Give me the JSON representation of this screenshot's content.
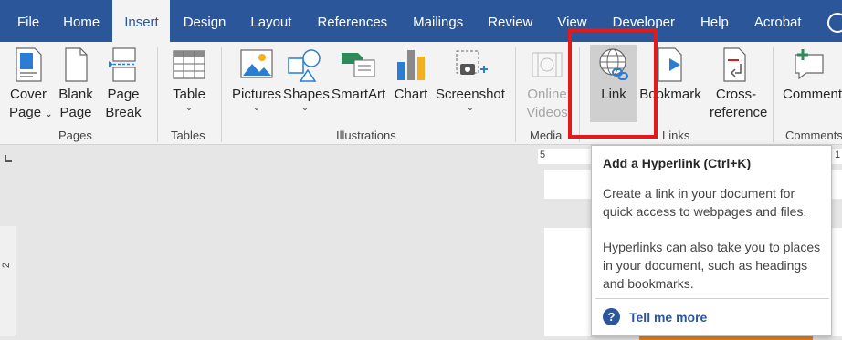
{
  "tabs": [
    {
      "label": "File"
    },
    {
      "label": "Home"
    },
    {
      "label": "Insert"
    },
    {
      "label": "Design"
    },
    {
      "label": "Layout"
    },
    {
      "label": "References"
    },
    {
      "label": "Mailings"
    },
    {
      "label": "Review"
    },
    {
      "label": "View"
    },
    {
      "label": "Developer"
    },
    {
      "label": "Help"
    },
    {
      "label": "Acrobat"
    }
  ],
  "active_tab": "Insert",
  "ribbon": {
    "pages": {
      "group_label": "Pages",
      "cover_page": {
        "line1": "Cover",
        "line2": "Page"
      },
      "blank_page": {
        "line1": "Blank",
        "line2": "Page"
      },
      "page_break": {
        "line1": "Page",
        "line2": "Break"
      }
    },
    "tables": {
      "group_label": "Tables",
      "table": {
        "label": "Table"
      }
    },
    "illustrations": {
      "group_label": "Illustrations",
      "pictures": {
        "label": "Pictures"
      },
      "shapes": {
        "label": "Shapes"
      },
      "smartart": {
        "label": "SmartArt"
      },
      "chart": {
        "label": "Chart"
      },
      "screenshot": {
        "label": "Screenshot"
      }
    },
    "media": {
      "group_label": "Media",
      "online_videos": {
        "line1": "Online",
        "line2": "Videos"
      }
    },
    "links": {
      "group_label": "Links",
      "link": {
        "label": "Link"
      },
      "bookmark": {
        "label": "Bookmark"
      },
      "cross_reference": {
        "line1": "Cross-",
        "line2": "reference"
      }
    },
    "comments": {
      "group_label": "Comments",
      "comment": {
        "label": "Comment"
      }
    }
  },
  "ruler": {
    "h_numbers": [
      "5",
      "1"
    ],
    "v_number": "2"
  },
  "tooltip": {
    "title": "Add a Hyperlink (Ctrl+K)",
    "para1": "Create a link in your document for quick access to webpages and files.",
    "para2": "Hyperlinks can also take you to places in your document, such as headings and bookmarks.",
    "help_link": "Tell me more"
  },
  "colors": {
    "tab_bar": "#2b579a",
    "highlight": "#e3191b",
    "ribbon_bg": "#f3f3f3"
  }
}
